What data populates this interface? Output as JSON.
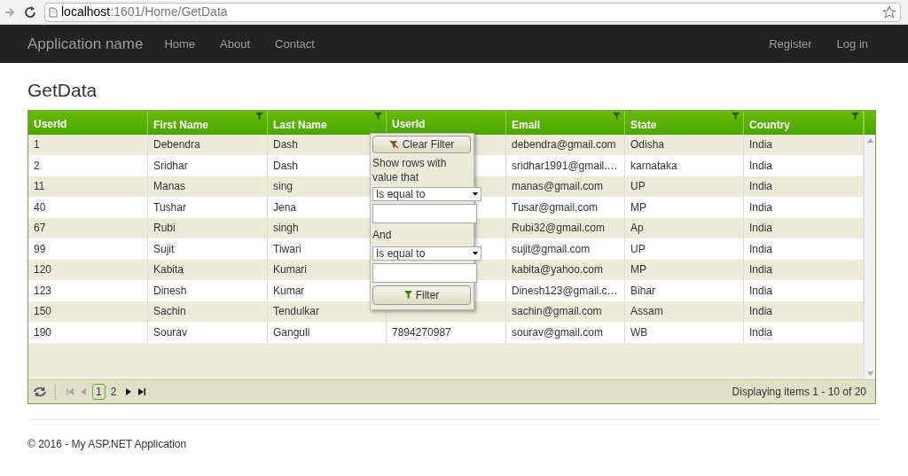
{
  "browser": {
    "url_host": "localhost",
    "url_path": ":1601/Home/GetData"
  },
  "navbar": {
    "brand": "Application name",
    "links": [
      "Home",
      "About",
      "Contact"
    ],
    "right_links": [
      "Register",
      "Log in"
    ]
  },
  "page_title": "GetData",
  "grid": {
    "columns": [
      {
        "label": "UserId",
        "filterable": false
      },
      {
        "label": "First Name",
        "filterable": true
      },
      {
        "label": "Last Name",
        "filterable": true
      },
      {
        "label": "UserId",
        "filterable": false
      },
      {
        "label": "Email",
        "filterable": true
      },
      {
        "label": "State",
        "filterable": true
      },
      {
        "label": "Country",
        "filterable": true
      }
    ],
    "rows": [
      {
        "user_id": "1",
        "first_name": "Debendra",
        "last_name": "Dash",
        "email": "debendra@gmail.com",
        "state": "Odisha",
        "country": "India"
      },
      {
        "user_id": "2",
        "first_name": "Sridhar",
        "last_name": "Dash",
        "email": "sridhar1991@gmail.…",
        "state": "karnataka",
        "country": "India"
      },
      {
        "user_id": "11",
        "first_name": "Manas",
        "last_name": "sing",
        "email": "manas@gmail.com",
        "state": "UP",
        "country": "India"
      },
      {
        "user_id": "40",
        "first_name": "Tushar",
        "last_name": "Jena",
        "email": "Tusar@gmail.com",
        "state": "MP",
        "country": "India"
      },
      {
        "user_id": "67",
        "first_name": "Rubi",
        "last_name": "singh",
        "email": "Rubi32@gmail.com",
        "state": "Ap",
        "country": "India"
      },
      {
        "user_id": "99",
        "first_name": "Sujit",
        "last_name": "Tiwari",
        "email": "sujit@gmail.com",
        "state": "UP",
        "country": "India"
      },
      {
        "user_id": "120",
        "first_name": "Kabita",
        "last_name": "Kumari",
        "email": "kabita@yahoo.com",
        "state": "MP",
        "country": "India"
      },
      {
        "user_id": "123",
        "first_name": "Dinesh",
        "last_name": "Kumar",
        "email": "Dinesh123@gmail.c…",
        "state": "Bihar",
        "country": "India"
      },
      {
        "user_id": "150",
        "first_name": "Sachin",
        "last_name": "Tendulkar",
        "email": "sachin@gmail.com",
        "state": "Assam",
        "country": "India"
      },
      {
        "user_id": "190",
        "first_name": "Sourav",
        "last_name": "Ganguli",
        "user_id_2": "7894270987",
        "email": "sourav@gmail.com",
        "state": "WB",
        "country": "India"
      }
    ],
    "filter_menu": {
      "clear_button": "Clear Filter",
      "prompt": "Show rows with value that",
      "operator_1": "Is equal to",
      "conjunction": "And",
      "operator_2": "Is equal to",
      "filter_button": "Filter"
    },
    "pager": {
      "pages": [
        {
          "label": "1",
          "selected": true
        },
        {
          "label": "2",
          "selected": false
        }
      ],
      "first_disabled": true,
      "prev_disabled": true,
      "info": "Displaying items 1 - 10 of 20"
    }
  },
  "footer": "© 2016 - My ASP.NET Application"
}
